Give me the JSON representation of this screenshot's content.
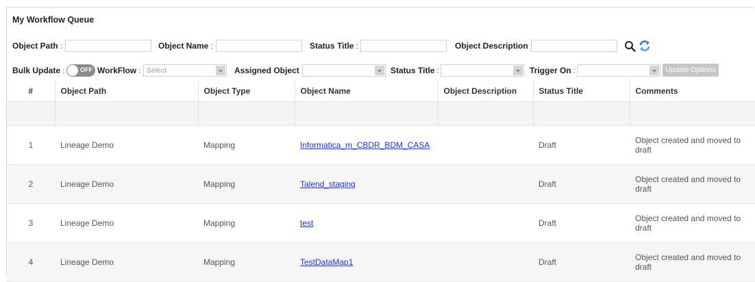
{
  "panel": {
    "title": "My Workflow Queue"
  },
  "search": {
    "object_path_label": "Object Path",
    "object_name_label": "Object Name",
    "status_title_label": "Status Title",
    "object_description_label": "Object Description",
    "colon": ":"
  },
  "bulk": {
    "bulk_update_label": "Bulk Update",
    "toggle_text": "OFF",
    "workflow_label": "WorkFlow",
    "workflow_placeholder": "Select",
    "assigned_object_label": "Assigned Object",
    "status_title_label": "Status Title",
    "trigger_on_label": "Trigger On",
    "update_button": "Update Options"
  },
  "table": {
    "headers": [
      "#",
      "Object Path",
      "Object Type",
      "Object Name",
      "Object Description",
      "Status Title",
      "Comments"
    ],
    "rows": [
      {
        "num": "1",
        "path": "Lineage Demo",
        "type": "Mapping",
        "name": "Informatica_m_CBDR_BDM_CASA",
        "description": "",
        "status": "Draft",
        "comments": "Object created and moved to draft"
      },
      {
        "num": "2",
        "path": "Lineage Demo",
        "type": "Mapping",
        "name": "Talend_staging",
        "description": "",
        "status": "Draft",
        "comments": "Object created and moved to draft"
      },
      {
        "num": "3",
        "path": "Lineage Demo",
        "type": "Mapping",
        "name": "test",
        "description": "",
        "status": "Draft",
        "comments": "Object created and moved to draft"
      },
      {
        "num": "4",
        "path": "Lineage Demo",
        "type": "Mapping",
        "name": "TestDataMap1",
        "description": "",
        "status": "Draft",
        "comments": "Object created and moved to draft"
      }
    ]
  },
  "icons": {
    "search": "search-icon",
    "refresh": "refresh-icon"
  },
  "colors": {
    "link": "#1a34c8",
    "toggle_off": "#8a8a8a",
    "button_disabled": "#c6c6c6"
  }
}
